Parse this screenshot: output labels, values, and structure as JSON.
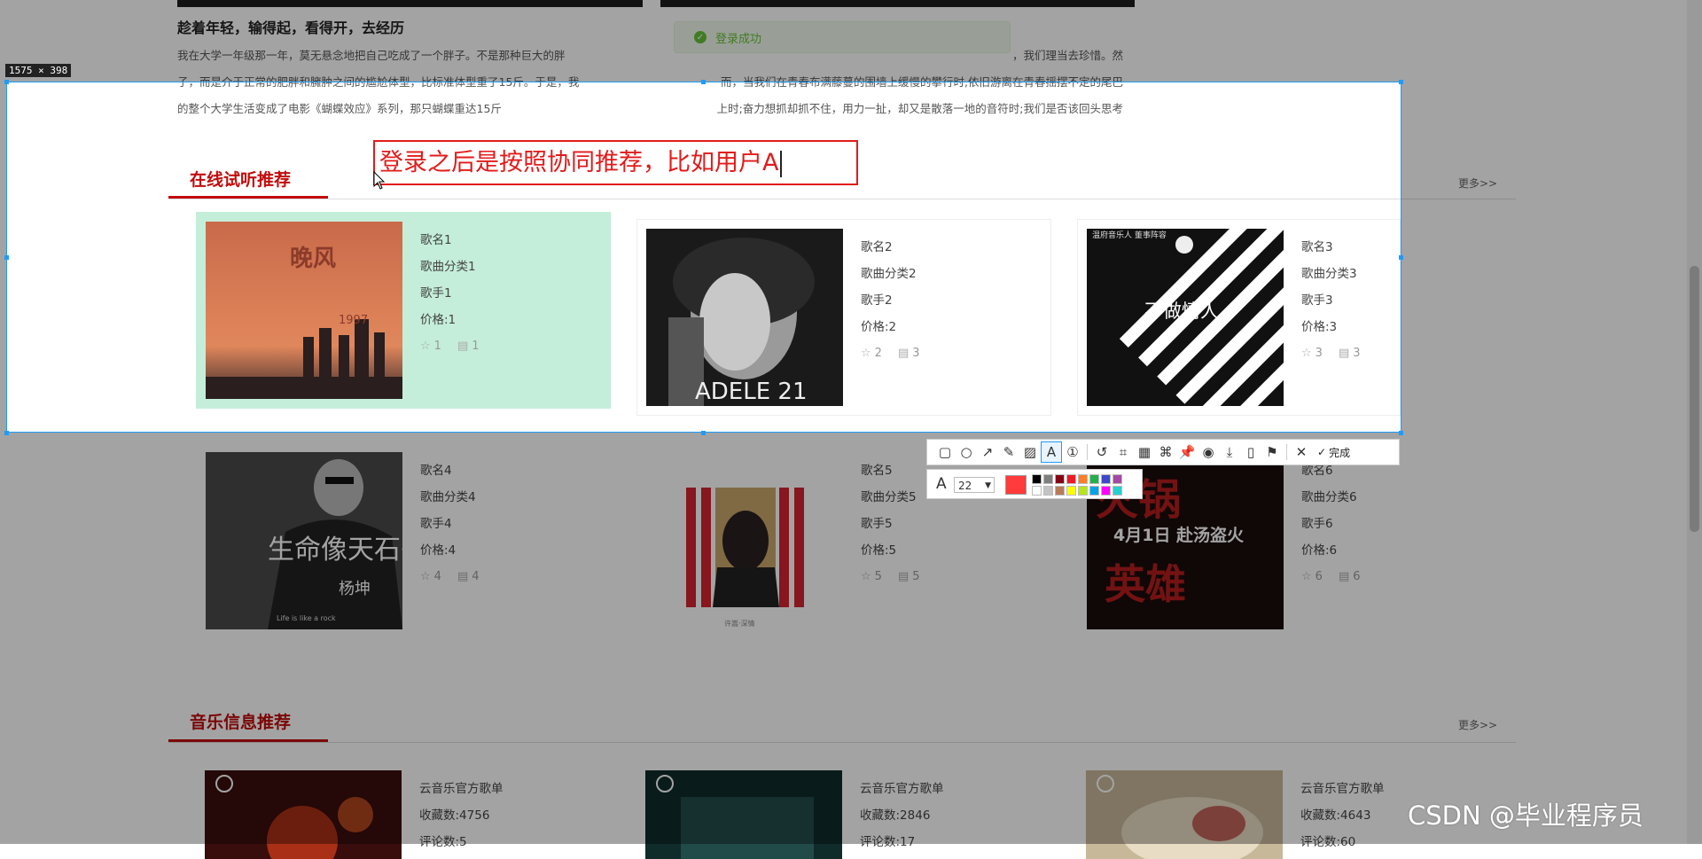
{
  "article": {
    "left": {
      "title": "趁着年轻，输得起，看得开，去经历",
      "lines": [
        "我在大学一年级那一年，莫无悬念地把自己吃成了一个胖子。不是那种巨大的胖",
        "子，而是介于正常的肥胖和臃肿之间的尴尬体型，比标准体型重了15斤。于是，我",
        "的整个大学生活变成了电影《蝴蝶效应》系列，那只蝴蝶重达15斤"
      ]
    },
    "right": {
      "lines": [
        "，我们理当去珍惜。然",
        "而，当我们在青春布满藤蔓的围墙上缓慢的攀行时,依旧游离在青春摇摆不定的尾巴",
        "上时;奋力想抓却抓不住，用力一扯，却又是散落一地的音符时;我们是否该回头思考"
      ]
    }
  },
  "toast": {
    "text": "登录成功"
  },
  "section1": {
    "title": "在线试听推荐",
    "more": "更多>>"
  },
  "section2": {
    "title": "音乐信息推荐",
    "more": "更多>>"
  },
  "songs": [
    {
      "name": "歌名1",
      "category": "歌曲分类1",
      "singer": "歌手1",
      "price": "价格:1",
      "likes": "1",
      "comments": "1"
    },
    {
      "name": "歌名2",
      "category": "歌曲分类2",
      "singer": "歌手2",
      "price": "价格:2",
      "likes": "2",
      "comments": "3"
    },
    {
      "name": "歌名3",
      "category": "歌曲分类3",
      "singer": "歌手3",
      "price": "价格:3",
      "likes": "3",
      "comments": "3"
    },
    {
      "name": "歌名4",
      "category": "歌曲分类4",
      "singer": "歌手4",
      "price": "价格:4",
      "likes": "4",
      "comments": "4"
    },
    {
      "name": "歌名5",
      "category": "歌曲分类5",
      "singer": "歌手5",
      "price": "价格:5",
      "likes": "5",
      "comments": "5"
    },
    {
      "name": "歌名6",
      "category": "歌曲分类6",
      "singer": "歌手6",
      "price": "价格:6",
      "likes": "6",
      "comments": "6"
    }
  ],
  "playlists": [
    {
      "owner": "云音乐官方歌单",
      "favorites": "收藏数:4756",
      "comments": "评论数:5"
    },
    {
      "owner": "云音乐官方歌单",
      "favorites": "收藏数:2846",
      "comments": "评论数:17"
    },
    {
      "owner": "云音乐官方歌单",
      "favorites": "收藏数:4643",
      "comments": "评论数:60"
    }
  ],
  "covers": {
    "c1_title": "晚风",
    "c1_year": "1997",
    "c2_text": "ADELE 21",
    "c3_text": "不做情人",
    "c3_top": "温府音乐人 董事阵容",
    "c4_text": "生命像天石头",
    "c4_name": "杨坤",
    "c4_sub": "Life is like a rock",
    "c5_sub": "许嵩·深情",
    "c6_text": "4月1日 赴汤盗火",
    "c6_big": "火锅英雄"
  },
  "capture": {
    "size_label": "1575 × 398",
    "annotation_text": "登录之后是按照协同推荐，比如用户A",
    "font_size": "22",
    "done_label": "完成",
    "current_color": "#ff3b3b",
    "palette": [
      "#000000",
      "#7f7f7f",
      "#880015",
      "#ed1c24",
      "#ff7f27",
      "#22b14c",
      "#3f48cc",
      "#a349a4",
      "#ffffff",
      "#c3c3c3",
      "#b97a57",
      "#ffff00",
      "#b5e61d",
      "#00a2e8",
      "#ff00ff",
      "#27d0d0"
    ],
    "tools": [
      "rectangle-icon",
      "ellipse-icon",
      "arrow-icon",
      "pen-icon",
      "mosaic-icon",
      "text-icon",
      "number-icon",
      "undo-icon",
      "crop-icon",
      "ocr-icon",
      "translate-icon",
      "pin-icon",
      "record-icon",
      "download-icon",
      "save-icon",
      "bookmark-icon",
      "close-icon"
    ]
  },
  "watermark": "CSDN @毕业程序员"
}
